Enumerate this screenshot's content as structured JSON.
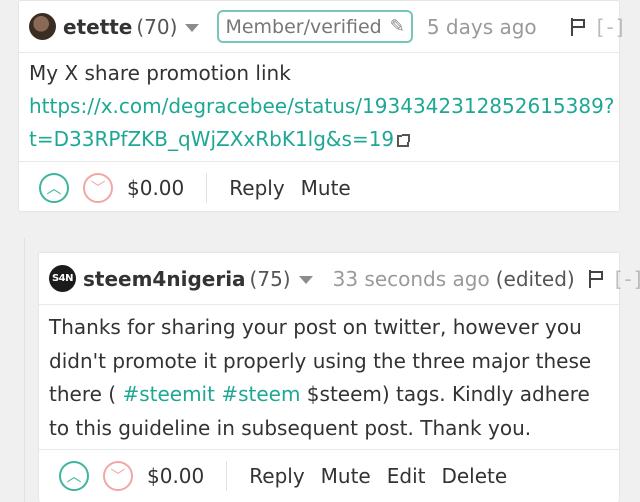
{
  "comments": [
    {
      "author": "etette",
      "reputation": "(70)",
      "badge": "Member/verified",
      "badge_icon": "pen-icon",
      "time": "5 days ago",
      "edited": "",
      "collapse": "[-]",
      "body_line1": "My X share promotion link",
      "link_line1": "https://x.com/degracebee/status/1934342312852615389?",
      "link_line2": "t=D33RPfZKB_qWjZXxRbK1lg&s=19",
      "payout": "$0.00",
      "actions": {
        "reply": "Reply",
        "mute": "Mute"
      }
    },
    {
      "author": "steem4nigeria",
      "avatar_text": "S4N",
      "reputation": "(75)",
      "time": "33 seconds ago",
      "edited": "(edited)",
      "collapse": "[-]",
      "body_text1": "Thanks for sharing your post on twitter, however you didn't promote it properly using the three major these there (",
      "tag1": "#steemit",
      "tag2": "#steem",
      "body_text2": "$steem) tags. Kindly adhere to this guideline in subsequent post. Thank you.",
      "payout": "$0.00",
      "actions": {
        "reply": "Reply",
        "mute": "Mute",
        "edit": "Edit",
        "delete": "Delete"
      }
    }
  ],
  "colors": {
    "accent": "#1ea894",
    "upvote": "#3fb59e",
    "downvote": "#f2a7a7",
    "badge_border": "#76c7b9",
    "background": "#f0f0f0"
  },
  "icons": {
    "upvote": "chevron-up-icon",
    "downvote": "chevron-down-icon",
    "flag": "flag-icon",
    "external_link": "external-link-icon",
    "menu": "caret-down-icon"
  }
}
